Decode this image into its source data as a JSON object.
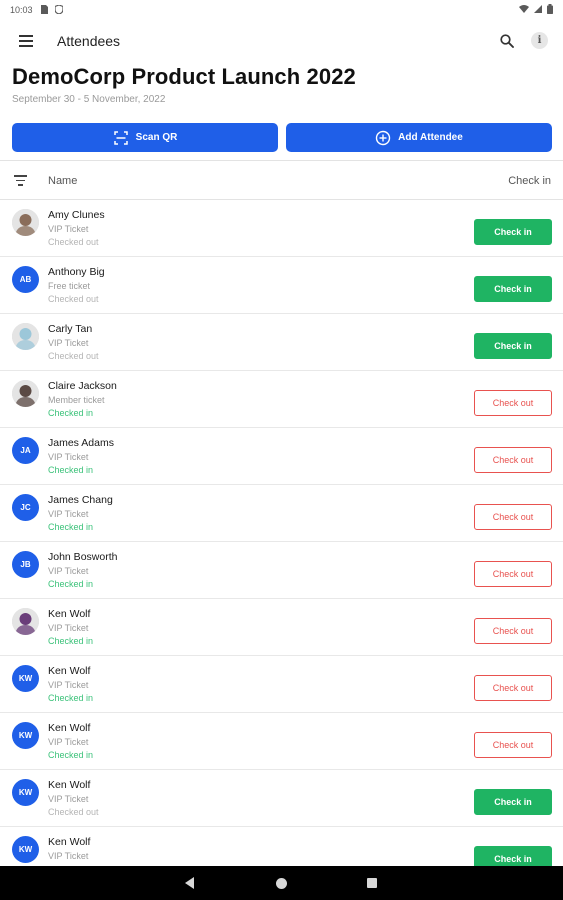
{
  "status_bar": {
    "time": "10:03",
    "icons": [
      "sd-card-icon",
      "shield-icon",
      "wifi-icon",
      "signal-icon",
      "battery-icon"
    ]
  },
  "app_bar": {
    "title": "Attendees",
    "icons": [
      "menu-icon",
      "search-icon",
      "info-icon"
    ],
    "info_glyph": "i"
  },
  "event": {
    "title": "DemoCorp Product Launch 2022",
    "dates": "September 30 - 5 November, 2022"
  },
  "actions": {
    "scan_label": "Scan QR",
    "add_label": "Add Attendee"
  },
  "list_header": {
    "name_label": "Name",
    "checkin_label": "Check in"
  },
  "colors": {
    "primary": "#1f5fe8",
    "checkin_green": "#1fb463",
    "checkout_red": "#e8524f",
    "status_in_green": "#3cc27a"
  },
  "attendees": [
    {
      "name": "Amy Clunes",
      "ticket": "VIP Ticket",
      "status": "Checked out",
      "action": "Check in",
      "avatar": "photo",
      "photo_tone": "#8a6d5a"
    },
    {
      "name": "Anthony Big",
      "ticket": "Free ticket",
      "status": "Checked out",
      "action": "Check in",
      "avatar": "AB"
    },
    {
      "name": "Carly Tan",
      "ticket": "VIP Ticket",
      "status": "Checked out",
      "action": "Check in",
      "avatar": "photo",
      "photo_tone": "#9cc7d9"
    },
    {
      "name": "Claire Jackson",
      "ticket": "Member ticket",
      "status": "Checked in",
      "action": "Check out",
      "avatar": "photo",
      "photo_tone": "#5b4a44"
    },
    {
      "name": "James Adams",
      "ticket": "VIP Ticket",
      "status": "Checked in",
      "action": "Check out",
      "avatar": "JA"
    },
    {
      "name": "James Chang",
      "ticket": "VIP Ticket",
      "status": "Checked in",
      "action": "Check out",
      "avatar": "JC"
    },
    {
      "name": "John Bosworth",
      "ticket": "VIP Ticket",
      "status": "Checked in",
      "action": "Check out",
      "avatar": "JB"
    },
    {
      "name": "Ken Wolf",
      "ticket": "VIP Ticket",
      "status": "Checked in",
      "action": "Check out",
      "avatar": "photo",
      "photo_tone": "#6a3d7a"
    },
    {
      "name": "Ken Wolf",
      "ticket": "VIP Ticket",
      "status": "Checked in",
      "action": "Check out",
      "avatar": "KW"
    },
    {
      "name": "Ken Wolf",
      "ticket": "VIP Ticket",
      "status": "Checked in",
      "action": "Check out",
      "avatar": "KW"
    },
    {
      "name": "Ken Wolf",
      "ticket": "VIP Ticket",
      "status": "Checked out",
      "action": "Check in",
      "avatar": "KW"
    },
    {
      "name": "Ken Wolf",
      "ticket": "VIP Ticket",
      "status": "",
      "action": "Check in",
      "avatar": "KW"
    }
  ],
  "nav_bar": {
    "icons": [
      "back-icon",
      "home-icon",
      "recents-icon"
    ]
  }
}
